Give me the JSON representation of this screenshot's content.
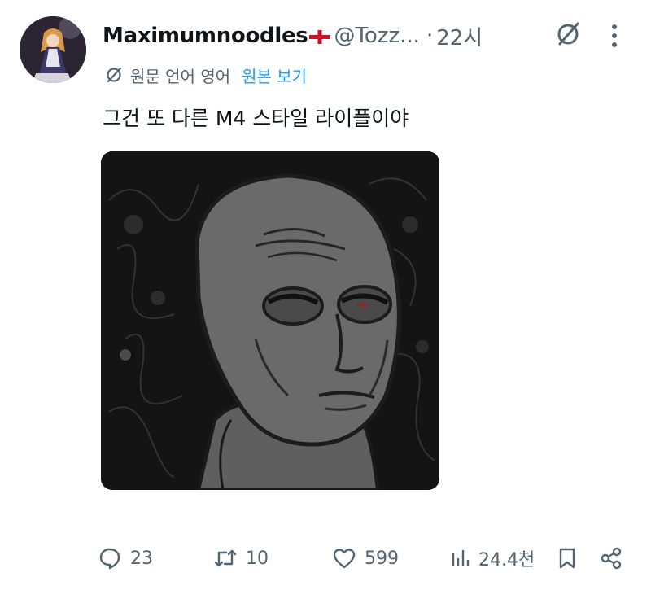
{
  "user": {
    "display_name": "Maximumnoodles",
    "flag_icon": "england-flag-icon",
    "handle": "@Tozz...",
    "separator": "·",
    "time": "22시"
  },
  "translation": {
    "label": "원문 언어 영어",
    "show_original": "원본 보기"
  },
  "tweet": {
    "text": "그건 또 다른 M4 스타일 라이플이야"
  },
  "actions": {
    "replies": "23",
    "retweets": "10",
    "likes": "599",
    "views": "24.4천"
  },
  "colors": {
    "text_primary": "#0f1419",
    "text_secondary": "#536471",
    "link": "#1d9bf0"
  }
}
